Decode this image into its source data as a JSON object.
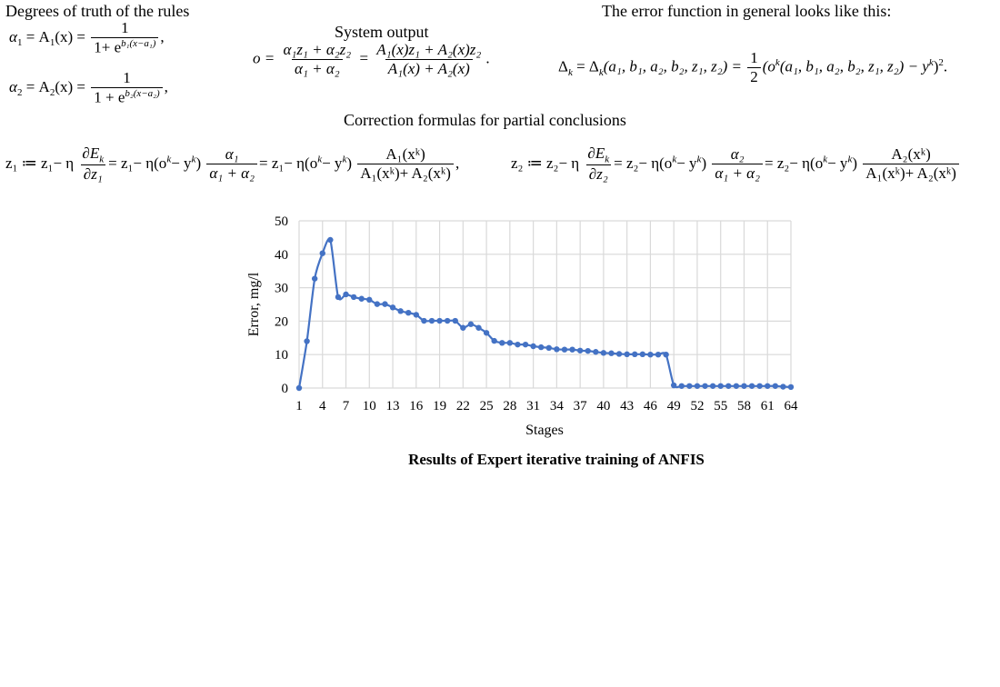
{
  "sections": {
    "degrees_title": "Degrees of truth of the rules",
    "system_output_title": "System output",
    "error_title": "The error function in general looks like this:",
    "correction_title": "Correction formulas for partial conclusions"
  },
  "formulas": {
    "alpha1": {
      "lhs": "α",
      "idx": "1",
      "mid": "= A",
      "arg": "(x) =",
      "num": "1",
      "den_base": "1+ e",
      "den_exp": "b₁(x−a₁)",
      "tail": ","
    },
    "alpha2": {
      "lhs": "α",
      "idx": "2",
      "mid": "= A",
      "arg": "(x) =",
      "num": "1",
      "den_base": "1 + e",
      "den_exp": "b₂(x−a₂)",
      "tail": ","
    },
    "system_output": {
      "lhs": "o =",
      "frac1_num": "α₁z₁ + α₂z₂",
      "frac1_den": "α₁ + α₂",
      "eq": "=",
      "frac2_num": "A₁(x)z₁ + A₂(x)z₂",
      "frac2_den": "A₁(x) + A₂(x)",
      "tail": "."
    },
    "error_function": {
      "lhs": "Δ",
      "lhs_sub": "k",
      "expr1": " = Δ",
      "expr1_sub": "k",
      "args": "(a₁, b₁, a₂, b₂, z₁, z₂) =",
      "half_num": "1",
      "half_den": "2",
      "body": "(o",
      "body_sup": "k",
      "body2": "(a₁, b₁, a₂, b₂, z₁, z₂) − y",
      "body2_sup": "k",
      "close": ")",
      "close_sup": "2",
      "tail": "."
    },
    "z1": {
      "lhs": "z₁ ≔ z₁− η",
      "d_num": "∂E",
      "d_num_sub": "k",
      "d_den": "∂z₁",
      "part2": "= z₁− η(o",
      "part2_sup": "k",
      "part2b": "− y",
      "part2b_sup": "k",
      "part2c": ")",
      "f_num": "α₁",
      "f_den": "α₁ + α₂",
      "part3": "= z₁− η(o",
      "part3_sup": "k",
      "part3b": "− y",
      "part3b_sup": "k",
      "part3c": ")",
      "g_num": "A₁(xᵏ)",
      "g_den": "A₁(xᵏ)+ A₂(xᵏ)",
      "tail": ","
    },
    "z2": {
      "lhs": "z₂ ≔ z₂− η",
      "d_num": "∂E",
      "d_num_sub": "k",
      "d_den": "∂z₂",
      "part2": "= z₂− η(o",
      "part2_sup": "k",
      "part2b": "− y",
      "part2b_sup": "k",
      "part2c": ")",
      "f_num": "α₂",
      "f_den": "α₁ + α₂",
      "part3": "= z₂− η(o",
      "part3_sup": "k",
      "part3b": "− y",
      "part3b_sup": "k",
      "part3c": ")",
      "g_num": "A₂(xᵏ)",
      "g_den": "A₁(xᵏ)+ A₂(xᵏ)",
      "tail": ""
    }
  },
  "caption": "Results of Expert iterative training of ANFIS",
  "chart_data": {
    "type": "line",
    "title": "",
    "xlabel": "Stages",
    "ylabel": "Error, mg/l",
    "ylim": [
      0,
      50
    ],
    "yticks": [
      0,
      10,
      20,
      30,
      40,
      50
    ],
    "xlim": [
      1,
      64
    ],
    "xticks": [
      1,
      4,
      7,
      10,
      13,
      16,
      19,
      22,
      25,
      28,
      31,
      34,
      37,
      40,
      43,
      46,
      49,
      52,
      55,
      58,
      61,
      64
    ],
    "grid": true,
    "legend": "none",
    "series_color": "#4472c4",
    "grid_color": "#d9d9d9",
    "series": [
      {
        "name": "Error",
        "x": [
          1,
          2,
          3,
          4,
          5,
          6,
          7,
          8,
          9,
          10,
          11,
          12,
          13,
          14,
          15,
          16,
          17,
          18,
          19,
          20,
          21,
          22,
          23,
          24,
          25,
          26,
          27,
          28,
          29,
          30,
          31,
          32,
          33,
          34,
          35,
          36,
          37,
          38,
          39,
          40,
          41,
          42,
          43,
          44,
          45,
          46,
          47,
          48,
          49,
          50,
          51,
          52,
          53,
          54,
          55,
          56,
          57,
          58,
          59,
          60,
          61,
          62,
          63,
          64
        ],
        "values": [
          0,
          14,
          32.7,
          40.3,
          44.3,
          27.2,
          28,
          27.2,
          26.7,
          26.4,
          25.1,
          25.1,
          24.1,
          23,
          22.5,
          21.9,
          20.1,
          20.1,
          20.1,
          20.1,
          20.1,
          18,
          19.1,
          18,
          16.5,
          14.1,
          13.5,
          13.5,
          13,
          13,
          12.5,
          12.2,
          12,
          11.6,
          11.5,
          11.5,
          11.2,
          11.1,
          10.8,
          10.5,
          10.4,
          10.2,
          10.1,
          10.1,
          10.1,
          10,
          10,
          10,
          0.8,
          0.6,
          0.6,
          0.6,
          0.6,
          0.6,
          0.6,
          0.6,
          0.6,
          0.6,
          0.6,
          0.6,
          0.6,
          0.6,
          0.4,
          0.3
        ]
      }
    ]
  }
}
